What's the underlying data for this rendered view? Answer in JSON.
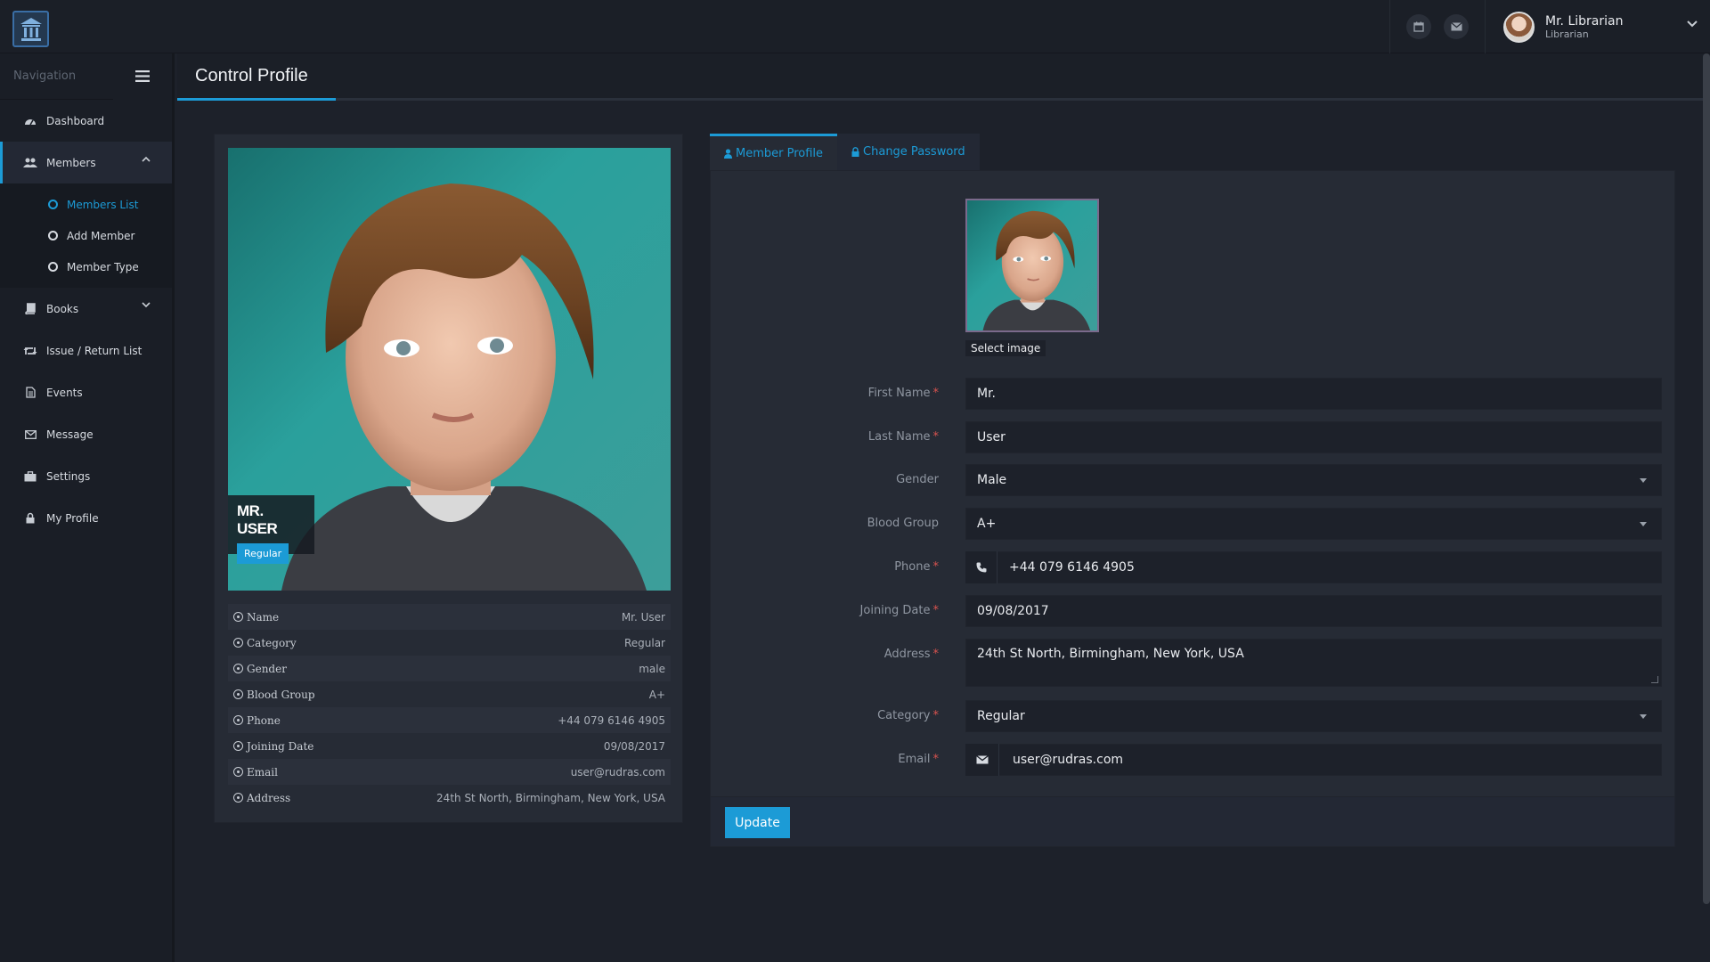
{
  "topbar": {
    "user_name": "Mr. Librarian",
    "user_role": "Librarian",
    "icons": [
      "calendar-icon",
      "envelope-icon"
    ]
  },
  "sidebar": {
    "nav_title": "Navigation",
    "items": [
      {
        "label": "Dashboard",
        "icon": "dashboard-icon"
      },
      {
        "label": "Members",
        "icon": "users-icon",
        "expanded": true
      },
      {
        "label": "Books",
        "icon": "book-icon"
      },
      {
        "label": "Issue / Return List",
        "icon": "retweet-icon"
      },
      {
        "label": "Events",
        "icon": "file-icon"
      },
      {
        "label": "Message",
        "icon": "envelope-icon"
      },
      {
        "label": "Settings",
        "icon": "briefcase-icon"
      },
      {
        "label": "My Profile",
        "icon": "lock-icon"
      }
    ],
    "members_sub": [
      {
        "label": "Members List",
        "active": true
      },
      {
        "label": "Add Member"
      },
      {
        "label": "Member Type"
      }
    ]
  },
  "page": {
    "title": "Control Profile"
  },
  "profile": {
    "name": "MR. USER",
    "badge": "Regular",
    "rows": [
      {
        "label": "Name",
        "value": "Mr. User"
      },
      {
        "label": "Category",
        "value": "Regular"
      },
      {
        "label": "Gender",
        "value": "male"
      },
      {
        "label": "Blood Group",
        "value": "A+"
      },
      {
        "label": "Phone",
        "value": "+44 079 6146 4905"
      },
      {
        "label": "Joining Date",
        "value": "09/08/2017"
      },
      {
        "label": "Email",
        "value": "user@rudras.com"
      },
      {
        "label": "Address",
        "value": "24th St North, Birmingham, New York, USA"
      }
    ]
  },
  "form": {
    "tabs": [
      {
        "label": "Member Profile",
        "icon": "user-icon",
        "active": true
      },
      {
        "label": "Change Password",
        "icon": "lock-icon"
      }
    ],
    "select_image": "Select image",
    "fields": {
      "first_name": {
        "label": "First Name",
        "value": "Mr."
      },
      "last_name": {
        "label": "Last Name",
        "value": "User"
      },
      "gender": {
        "label": "Gender",
        "value": "Male"
      },
      "blood_group": {
        "label": "Blood Group",
        "value": "A+"
      },
      "phone": {
        "label": "Phone",
        "value": "+44 079 6146 4905"
      },
      "joining_date": {
        "label": "Joining Date",
        "value": "09/08/2017"
      },
      "address": {
        "label": "Address",
        "value": "24th St North, Birmingham, New York, USA"
      },
      "category": {
        "label": "Category",
        "value": "Regular"
      },
      "email": {
        "label": "Email",
        "value": "user@rudras.com"
      }
    },
    "update_label": "Update"
  },
  "colors": {
    "accent": "#1c9bd6",
    "background": "#1d212a",
    "panel": "#262b35",
    "required": "#d9534f"
  }
}
